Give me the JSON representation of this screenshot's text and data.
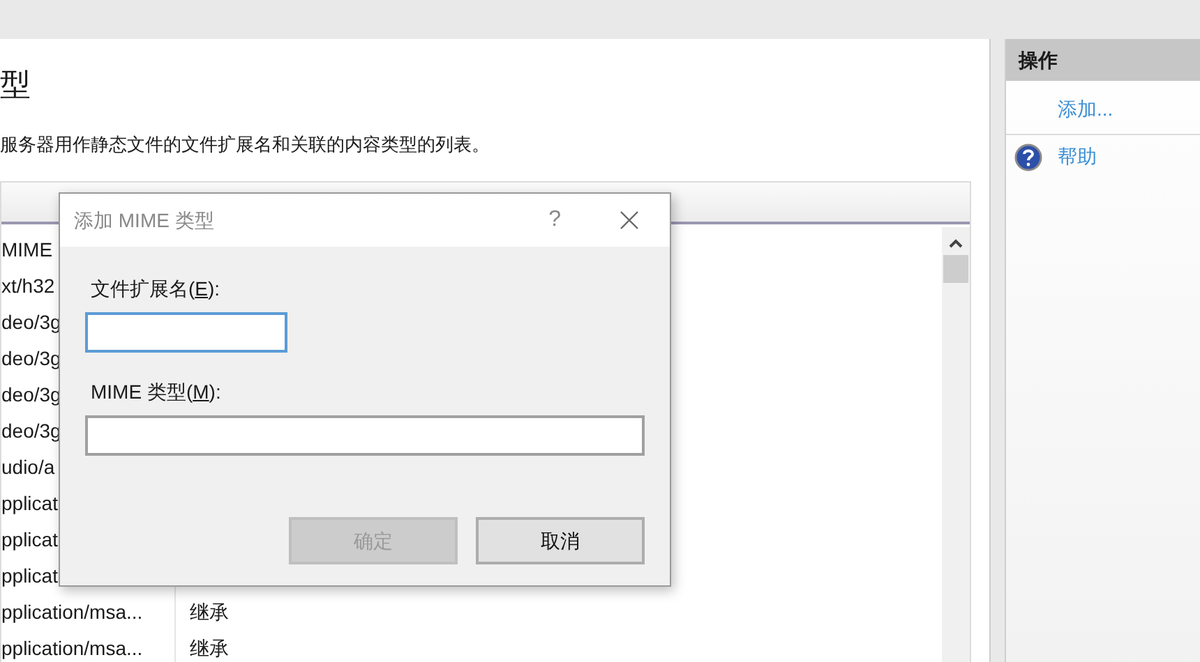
{
  "page": {
    "heading": "型",
    "description": "服务器用作静态文件的文件扩展名和关联的内容类型的列表。"
  },
  "table": {
    "rows": [
      {
        "column_1": "MIME"
      },
      {
        "column_1": "xt/h32"
      },
      {
        "column_1": "deo/3g"
      },
      {
        "column_1": "deo/3g"
      },
      {
        "column_1": "deo/3g"
      },
      {
        "column_1": "deo/3g"
      },
      {
        "column_1": "udio/a"
      },
      {
        "column_1": "pplicat"
      },
      {
        "column_1": "pplicat"
      },
      {
        "column_1": "pplicat"
      },
      {
        "column_1": "pplication/msa...",
        "column_2": "继承"
      },
      {
        "column_1": "pplication/msa...",
        "column_2": "继承"
      }
    ]
  },
  "actions": {
    "title": "操作",
    "items": [
      {
        "kind": "link",
        "label": "添加..."
      },
      {
        "kind": "help",
        "label": "帮助"
      }
    ]
  },
  "dialog": {
    "title": "添加 MIME 类型",
    "help": "?",
    "fields": [
      {
        "label": "文件扩展名(**E**):",
        "focused": true,
        "wide": false
      },
      {
        "label": "MIME 类型(**M**):",
        "focused": false,
        "wide": true
      }
    ],
    "buttons": [
      {
        "label": "确定",
        "disabled": true
      },
      {
        "label": "取消",
        "disabled": false
      }
    ]
  }
}
